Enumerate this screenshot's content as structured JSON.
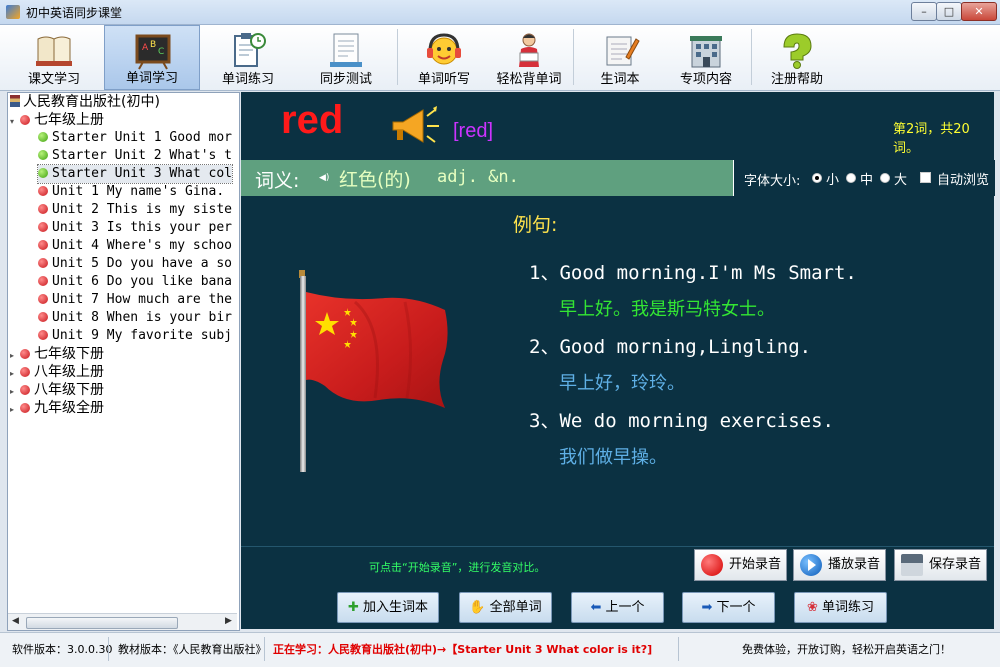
{
  "window": {
    "title": "初中英语同步课堂",
    "min": "–",
    "max": "□",
    "close": "✕"
  },
  "toolbar": [
    {
      "label": "课文学习",
      "icon": "book-icon"
    },
    {
      "label": "单词学习",
      "icon": "abc-board-icon",
      "active": true
    },
    {
      "label": "单词练习",
      "icon": "clipboard-clock-icon"
    },
    {
      "label": "同步测试",
      "icon": "test-paper-icon"
    },
    {
      "label": "单词听写",
      "icon": "headphones-face-icon"
    },
    {
      "label": "轻松背单词",
      "icon": "student-reading-icon"
    },
    {
      "label": "生词本",
      "icon": "notebook-pen-icon"
    },
    {
      "label": "专项内容",
      "icon": "building-icon"
    },
    {
      "label": "注册帮助",
      "icon": "help-icon"
    }
  ],
  "tree": {
    "root": "人民教育出版社(初中)",
    "grade1": "七年级上册",
    "units": [
      {
        "label": "Starter Unit 1 Good mor",
        "status": "green"
      },
      {
        "label": "Starter Unit 2 What's t",
        "status": "green"
      },
      {
        "label": "Starter Unit 3 What col",
        "status": "green",
        "selected": true
      },
      {
        "label": "Unit 1 My name's Gina.",
        "status": "red"
      },
      {
        "label": "Unit 2 This is my siste",
        "status": "red"
      },
      {
        "label": "Unit 3 Is this your per",
        "status": "red"
      },
      {
        "label": "Unit 4 Where's my schoo",
        "status": "red"
      },
      {
        "label": "Unit 5 Do you have a so",
        "status": "red"
      },
      {
        "label": "Unit 6 Do you like bana",
        "status": "red"
      },
      {
        "label": "Unit 7 How much are the",
        "status": "red"
      },
      {
        "label": "Unit 8 When is your bir",
        "status": "red"
      },
      {
        "label": "Unit 9 My favorite subj",
        "status": "red"
      }
    ],
    "other_grades": [
      "七年级下册",
      "八年级上册",
      "八年级下册",
      "九年级全册"
    ]
  },
  "word": {
    "text": "red",
    "phonetic": "[red]",
    "count": "第2词，共20词。",
    "meaning_label": "词义:",
    "meaning": "红色(的)",
    "pos": "adj. &n."
  },
  "font_size": {
    "label": "字体大小:",
    "small": "小",
    "medium": "中",
    "large": "大",
    "selected": "small",
    "auto_browse": "自动浏览"
  },
  "examples": {
    "title": "例句:",
    "items": [
      {
        "en": "1、Good morning.I'm Ms Smart.",
        "cn": "早上好。我是斯马特女士。",
        "cn_color": "#33e633"
      },
      {
        "en": "2、Good morning,Lingling.",
        "cn": "早上好，玲玲。",
        "cn_color": "#5fb0e6"
      },
      {
        "en": "3、We do morning exercises.",
        "cn": "我们做早操。",
        "cn_color": "#5fb0e6"
      }
    ]
  },
  "record": {
    "hint": "可点击“开始录音”，进行发音对比。",
    "start": "开始录音",
    "play": "播放录音",
    "save": "保存录音"
  },
  "nav": {
    "add": "加入生词本",
    "all": "全部单词",
    "prev": "上一个",
    "next": "下一个",
    "practice": "单词练习"
  },
  "status": {
    "version": "软件版本：3.0.0.30",
    "edition": "教材版本：《人民教育出版社》",
    "learning": "正在学习：人民教育出版社(初中)→【Starter Unit 3 What color is it?]",
    "promo": "免费体验，开放订购，轻松开启英语之门！"
  },
  "colors": {
    "panel_bg": "#0b3142",
    "word_red": "#ff1a1a",
    "meaning_bar": "#5fa07f",
    "highlight_yellow": "#ffe34c"
  }
}
